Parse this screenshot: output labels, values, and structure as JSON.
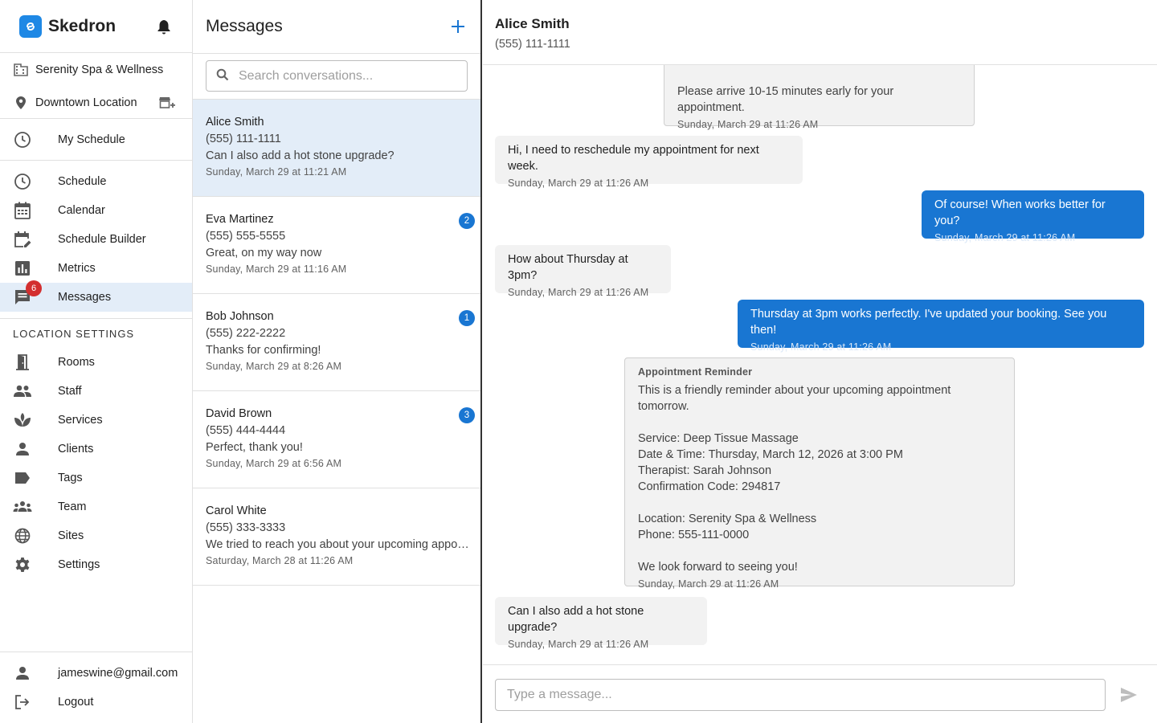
{
  "sidebar": {
    "brand": "Skedron",
    "org_name": "Serenity Spa & Wellness",
    "location_name": "Downtown Location",
    "my_schedule": "My Schedule",
    "nav": [
      {
        "label": "Schedule",
        "icon": "clock-icon"
      },
      {
        "label": "Calendar",
        "icon": "calendar-icon"
      },
      {
        "label": "Schedule Builder",
        "icon": "calendar-edit-icon"
      },
      {
        "label": "Metrics",
        "icon": "bar-chart-icon"
      },
      {
        "label": "Messages",
        "icon": "chat-icon",
        "badge": "6"
      }
    ],
    "location_settings_title": "LOCATION SETTINGS",
    "settings_nav": [
      {
        "label": "Rooms",
        "icon": "door-icon"
      },
      {
        "label": "Staff",
        "icon": "people-icon"
      },
      {
        "label": "Services",
        "icon": "spa-icon"
      },
      {
        "label": "Clients",
        "icon": "person-icon"
      },
      {
        "label": "Tags",
        "icon": "tag-icon"
      },
      {
        "label": "Team",
        "icon": "groups-icon"
      },
      {
        "label": "Sites",
        "icon": "globe-icon"
      },
      {
        "label": "Settings",
        "icon": "gear-icon"
      }
    ],
    "user_email": "jameswine@gmail.com",
    "logout": "Logout"
  },
  "conversations": {
    "title": "Messages",
    "search_placeholder": "Search conversations...",
    "items": [
      {
        "name": "Alice Smith",
        "phone": "(555) 111-1111",
        "preview": "Can I also add a hot stone upgrade?",
        "time": "Sunday, March 29 at 11:21 AM",
        "badge": ""
      },
      {
        "name": "Eva Martinez",
        "phone": "(555) 555-5555",
        "preview": "Great, on my way now",
        "time": "Sunday, March 29 at 11:16 AM",
        "badge": "2"
      },
      {
        "name": "Bob Johnson",
        "phone": "(555) 222-2222",
        "preview": "Thanks for confirming!",
        "time": "Sunday, March 29 at 8:26 AM",
        "badge": "1"
      },
      {
        "name": "David Brown",
        "phone": "(555) 444-4444",
        "preview": "Perfect, thank you!",
        "time": "Sunday, March 29 at 6:56 AM",
        "badge": "3"
      },
      {
        "name": "Carol White",
        "phone": "(555) 333-3333",
        "preview": "We tried to reach you about your upcoming appointment.",
        "time": "Saturday, March 28 at 11:26 AM",
        "badge": ""
      }
    ]
  },
  "chat": {
    "name": "Alice Smith",
    "phone": "(555) 111-1111",
    "messages": [
      {
        "type": "system",
        "text": "Please arrive 10-15 minutes early for your appointment.",
        "time": "Sunday, March 29 at 11:26 AM"
      },
      {
        "type": "in",
        "text": "Hi, I need to reschedule my appointment for next week.",
        "time": "Sunday, March 29 at 11:26 AM"
      },
      {
        "type": "out",
        "text": "Of course! When works better for you?",
        "time": "Sunday, March 29 at 11:26 AM"
      },
      {
        "type": "in",
        "text": "How about Thursday at 3pm?",
        "time": "Sunday, March 29 at 11:26 AM"
      },
      {
        "type": "out",
        "text": "Thursday at 3pm works perfectly. I've updated your booking. See you then!",
        "time": "Sunday, March 29 at 11:26 AM"
      },
      {
        "type": "system",
        "title": "Appointment Reminder",
        "text": "This is a friendly reminder about your upcoming appointment tomorrow.\n\nService: Deep Tissue Massage\nDate & Time: Thursday, March 12, 2026 at 3:00 PM\nTherapist: Sarah Johnson\nConfirmation Code: 294817\n\nLocation: Serenity Spa & Wellness\nPhone: 555-111-0000\n\nWe look forward to seeing you!",
        "time": "Sunday, March 29 at 11:26 AM"
      },
      {
        "type": "in",
        "text": "Can I also add a hot stone upgrade?",
        "time": "Sunday, March 29 at 11:26 AM"
      }
    ],
    "input_placeholder": "Type a message..."
  },
  "colors": {
    "accent": "#1976d2",
    "active_bg": "#e3edf8",
    "badge_red": "#d32f2f"
  }
}
